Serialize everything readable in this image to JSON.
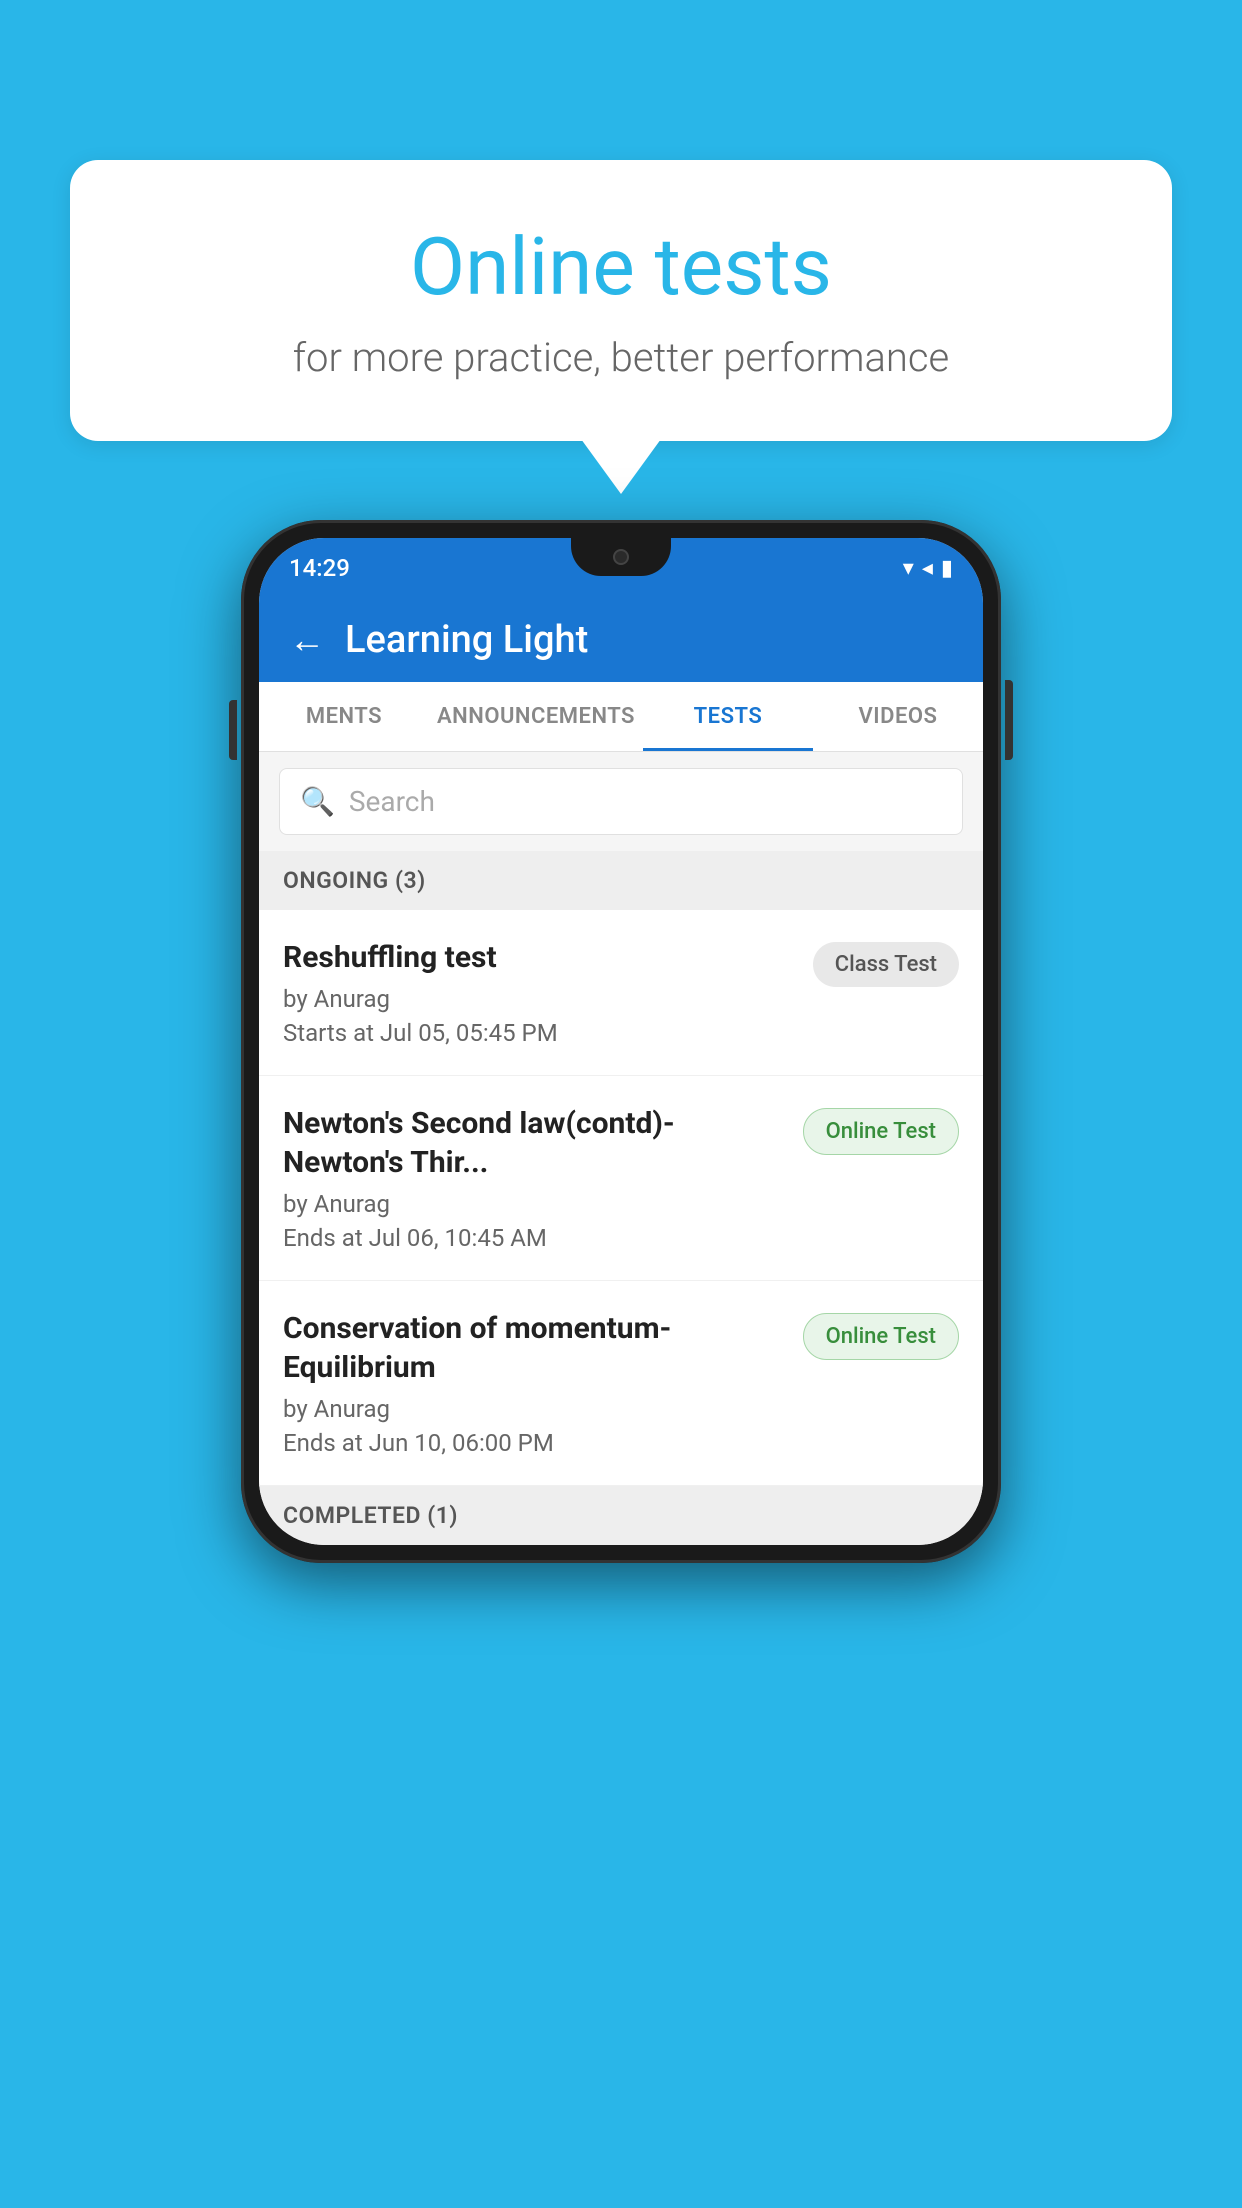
{
  "background_color": "#29b6e8",
  "bubble": {
    "title": "Online tests",
    "subtitle": "for more practice, better performance"
  },
  "phone": {
    "time": "14:29",
    "app_title": "Learning Light",
    "back_label": "←",
    "tabs": [
      {
        "label": "MENTS",
        "active": false
      },
      {
        "label": "ANNOUNCEMENTS",
        "active": false
      },
      {
        "label": "TESTS",
        "active": true
      },
      {
        "label": "VIDEOS",
        "active": false
      }
    ],
    "search": {
      "placeholder": "Search"
    },
    "section_ongoing": "ONGOING (3)",
    "section_completed": "COMPLETED (1)",
    "tests": [
      {
        "name": "Reshuffling test",
        "by": "by Anurag",
        "time": "Starts at  Jul 05, 05:45 PM",
        "badge": "Class Test",
        "badge_type": "class"
      },
      {
        "name": "Newton's Second law(contd)-Newton's Thir...",
        "by": "by Anurag",
        "time": "Ends at  Jul 06, 10:45 AM",
        "badge": "Online Test",
        "badge_type": "online"
      },
      {
        "name": "Conservation of momentum-Equilibrium",
        "by": "by Anurag",
        "time": "Ends at  Jun 10, 06:00 PM",
        "badge": "Online Test",
        "badge_type": "online"
      }
    ]
  }
}
